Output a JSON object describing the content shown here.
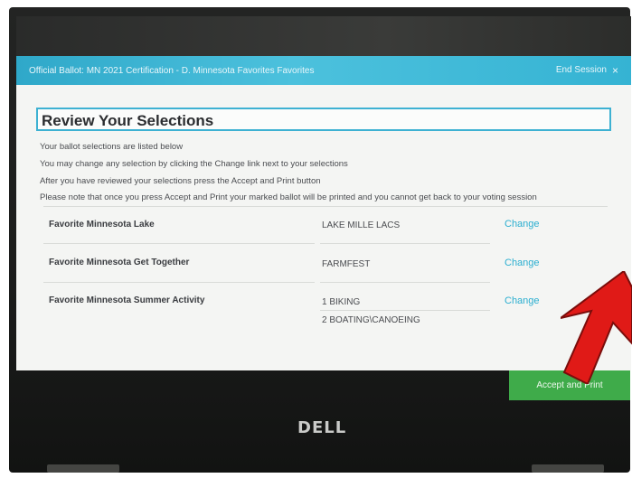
{
  "window": {
    "title": "Official Ballot: MN 2021 Certification - D. Minnesota Favorites Favorites",
    "end_session": "End Session"
  },
  "heading": "Review Your Selections",
  "instructions": [
    "Your ballot selections are listed below",
    "You may change any selection by clicking the Change link next to your selections",
    "After you have reviewed your selections press the Accept and Print button",
    "Please note that once you press Accept and Print your marked ballot will be printed and you cannot get back to your voting session"
  ],
  "selections": [
    {
      "label": "Favorite Minnesota Lake",
      "values": [
        "LAKE MILLE LACS"
      ],
      "change": "Change"
    },
    {
      "label": "Favorite Minnesota Get Together",
      "values": [
        "FARMFEST"
      ],
      "change": "Change"
    },
    {
      "label": "Favorite Minnesota Summer Activity",
      "values": [
        "1  BIKING",
        "2  BOATING\\CANOEING"
      ],
      "change": "Change"
    }
  ],
  "accept_print": "Accept and Print",
  "logo": "DELL",
  "colors": {
    "titlebar": "#35b3d3",
    "accent": "#2aaed0",
    "accept": "#3fab4a",
    "arrow": "#e01a17"
  }
}
